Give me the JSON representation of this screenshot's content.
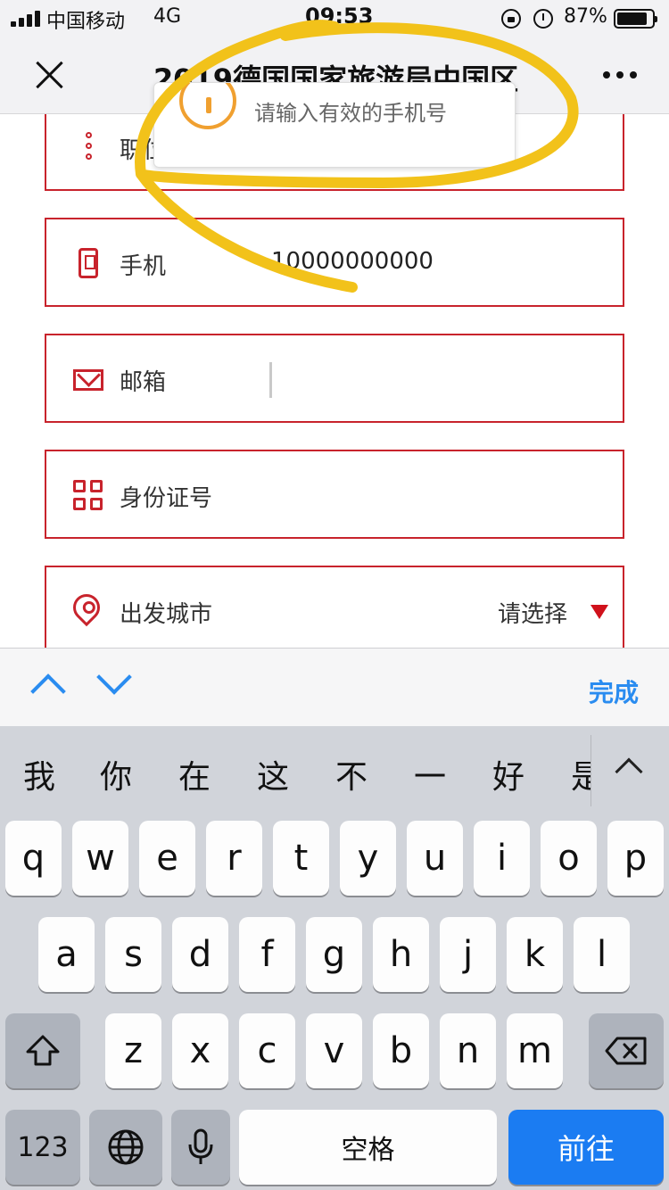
{
  "status_bar": {
    "carrier": "中国移动",
    "network": "4G",
    "time": "09:53",
    "battery_percent": "87%",
    "battery_level": 0.87,
    "icons": [
      "signal-icon",
      "lock-rotation-icon",
      "alarm-icon",
      "battery-icon"
    ]
  },
  "nav": {
    "title": "2019德国国家旅游局中国区",
    "close_icon": "close-icon",
    "more_icon": "more-icon"
  },
  "toast": {
    "message": "请输入有效的手机号",
    "icon": "warning-icon"
  },
  "form": {
    "fields": [
      {
        "label": "职位",
        "icon": "more-vertical-icon",
        "value": ""
      },
      {
        "label": "手机",
        "icon": "phone-icon",
        "value": "10000000000"
      },
      {
        "label": "邮箱",
        "icon": "mail-icon",
        "value": ""
      },
      {
        "label": "身份证号",
        "icon": "grid-icon",
        "value": ""
      },
      {
        "label": "出发城市",
        "icon": "location-pin-icon",
        "select_value": "请选择"
      }
    ],
    "accent_color": "#c8232c"
  },
  "accessory": {
    "done_label": "完成",
    "accent_color": "#2a8cf0"
  },
  "keyboard": {
    "candidates": [
      "我",
      "你",
      "在",
      "这",
      "不",
      "一",
      "好",
      "是"
    ],
    "row1": [
      "q",
      "w",
      "e",
      "r",
      "t",
      "y",
      "u",
      "i",
      "o",
      "p"
    ],
    "row2": [
      "a",
      "s",
      "d",
      "f",
      "g",
      "h",
      "j",
      "k",
      "l"
    ],
    "row3": [
      "z",
      "x",
      "c",
      "v",
      "b",
      "n",
      "m"
    ],
    "numbers_label": "123",
    "space_label": "空格",
    "go_label": "前往"
  }
}
